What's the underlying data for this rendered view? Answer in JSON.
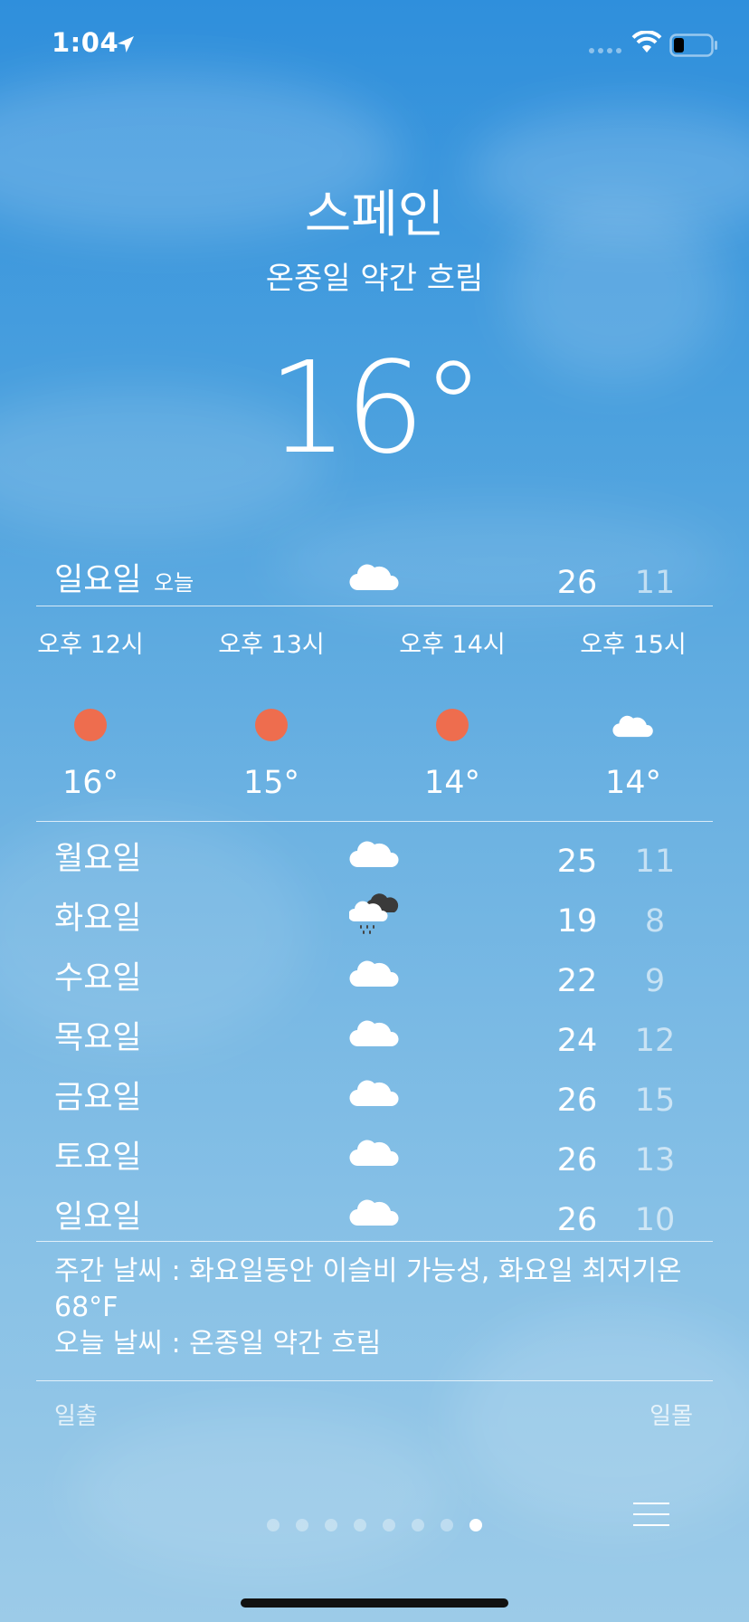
{
  "status_bar": {
    "time": "1:04"
  },
  "header": {
    "city": "스페인",
    "condition": "온종일 약간 흐림",
    "temperature": "16°"
  },
  "today": {
    "day": "일요일",
    "label": "오늘",
    "icon": "cloud-icon",
    "high": "26",
    "low": "11"
  },
  "hourly": [
    {
      "time": "오후 12시",
      "icon": "sun-icon",
      "temp": "16°"
    },
    {
      "time": "오후 13시",
      "icon": "sun-icon",
      "temp": "15°"
    },
    {
      "time": "오후 14시",
      "icon": "sun-icon",
      "temp": "14°"
    },
    {
      "time": "오후 15시",
      "icon": "cloud-icon",
      "temp": "14°"
    }
  ],
  "daily": [
    {
      "day": "월요일",
      "icon": "cloud-icon",
      "high": "25",
      "low": "11"
    },
    {
      "day": "화요일",
      "icon": "rain-cloud-icon",
      "high": "19",
      "low": "8"
    },
    {
      "day": "수요일",
      "icon": "cloud-icon",
      "high": "22",
      "low": "9"
    },
    {
      "day": "목요일",
      "icon": "cloud-icon",
      "high": "24",
      "low": "12"
    },
    {
      "day": "금요일",
      "icon": "cloud-icon",
      "high": "26",
      "low": "15"
    },
    {
      "day": "토요일",
      "icon": "cloud-icon",
      "high": "26",
      "low": "13"
    },
    {
      "day": "일요일",
      "icon": "cloud-icon",
      "high": "26",
      "low": "10"
    }
  ],
  "summary": {
    "line1": "주간 날씨 : 화요일동안 이슬비 가능성, 화요일 최저기온 68°F",
    "line2": "오늘 날씨 : 온종일 약간 흐림"
  },
  "sun": {
    "sunrise": "일출",
    "sunset": "일몰"
  },
  "pager": {
    "count": 8,
    "active_index": 7
  },
  "colors": {
    "sun": "#ee6d4e",
    "sky_top": "#2f8fdc",
    "sky_bottom": "#9ccbe8"
  }
}
